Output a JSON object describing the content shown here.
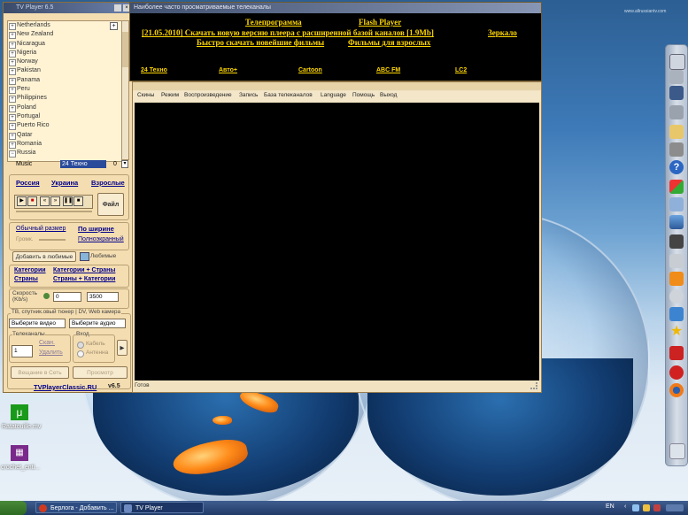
{
  "control_panel": {
    "title": "TV Player 6.5",
    "countries": [
      "Netherlands",
      "New Zealand",
      "Nicaragua",
      "Nigeria",
      "Norway",
      "Pakistan",
      "Panama",
      "Peru",
      "Philippines",
      "Poland",
      "Portugal",
      "Puerto Rico",
      "Qatar",
      "Romania",
      "Russia"
    ],
    "selected": {
      "category": "Music",
      "channel": "24 Техно",
      "number": "0"
    },
    "region_links": [
      "Россия",
      "Украина",
      "Взрослые"
    ],
    "file_button": "Файл",
    "size_links": {
      "normal": "Обычный размер",
      "width": "По ширине",
      "volume": "Громк.",
      "fullscreen": "Полноэкранный"
    },
    "favorites": {
      "add_button": "Добавить в любимые",
      "label": "Любимые"
    },
    "category_links": [
      "Категории",
      "Категории + Страны",
      "Страны",
      "Страны + Категории"
    ],
    "speed": {
      "label": "Скорость\n(Kb/s)",
      "min": "0",
      "max": "3500"
    },
    "tuner": {
      "legend": "TB, спутник.овый тюнер | DV, Web камера",
      "video_select": "Выберите видео",
      "audio_select": "Выберите аудио",
      "channels_legend": "Телеканалы",
      "channel_number": "1",
      "scan": "Скан.",
      "delete": "Удалить",
      "input_legend": "Вход",
      "cable": "Кабель",
      "antenna": "Антенна",
      "broadcast_button": "Вещание в Сеть",
      "view_button": "Просмотр"
    },
    "footer": {
      "site": "TVPlayerClassic.RU",
      "version": "v6.5"
    }
  },
  "banner": {
    "title": "Наиболее часто просматриваемые телеканалы",
    "links": {
      "tv_program": "Телепрограмма",
      "flash_player": "Flash Player",
      "download": "[21.05.2010] Скачать новую версию плеера с расширенной базой каналов [1.9Mb]",
      "mirror": "Зеркало",
      "movies": "Быстро скачать новейшие фильмы",
      "adult": "Фильмы для взрослых"
    },
    "channels": [
      "24 Техно",
      "Авто+",
      "Cartoon",
      "ABC FM",
      "LC2"
    ],
    "watermark": "www.allrussiantv.com"
  },
  "player": {
    "menu": [
      "Скины",
      "Режим",
      "Воспроизведение",
      "Запись",
      "База телеканалов",
      "Language",
      "Помощь",
      "Выход"
    ],
    "status": "Готов"
  },
  "desktop_icons": [
    {
      "label": "Ratatouille.mv",
      "color": "#1a9a1a",
      "glyph": "μ"
    },
    {
      "label": "crochet_enti...",
      "color": "#7a2a8a",
      "glyph": "▦"
    }
  ],
  "taskbar": {
    "tasks": [
      {
        "label": "Берлога - Добавить ...",
        "color": "#d23a20"
      },
      {
        "label": "TV Player",
        "color": "#2a4a8a"
      }
    ],
    "tray": {
      "lang": "EN"
    }
  }
}
